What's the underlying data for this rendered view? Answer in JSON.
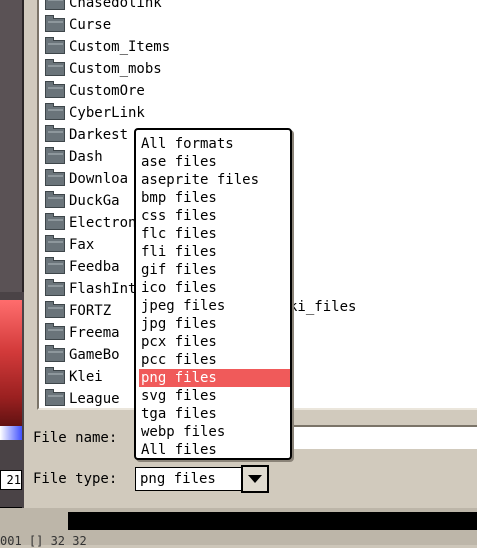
{
  "folders": [
    "Chasedolink",
    "Curse",
    "Custom_Items",
    "Custom_mobs",
    "CustomOre",
    "CyberLink",
    "Darkest",
    "Dash",
    "Downloa",
    "DuckGa",
    "Electron",
    "Fax",
    "Feedba",
    "FlashInt",
    "FORTZ",
    "Freema",
    "GameBo",
    "Klei",
    "League"
  ],
  "partial_list_text": "ki_files",
  "labels": {
    "file_name": "File name:",
    "file_type": "File type:"
  },
  "file_name_value": "",
  "file_type_value": "png files",
  "file_type_options": [
    "All formats",
    "ase files",
    "aseprite files",
    "bmp files",
    "css files",
    "flc files",
    "fli files",
    "gif files",
    "ico files",
    "jpeg files",
    "jpg files",
    "pcx files",
    "pcc files",
    "png files",
    "svg files",
    "tga files",
    "webp files",
    "All files"
  ],
  "selected_option": "png files",
  "left_value": "21",
  "status_text": "001  [] 32 32",
  "colors": {
    "highlight": "#f05a5a",
    "folder": "#6a747a"
  }
}
